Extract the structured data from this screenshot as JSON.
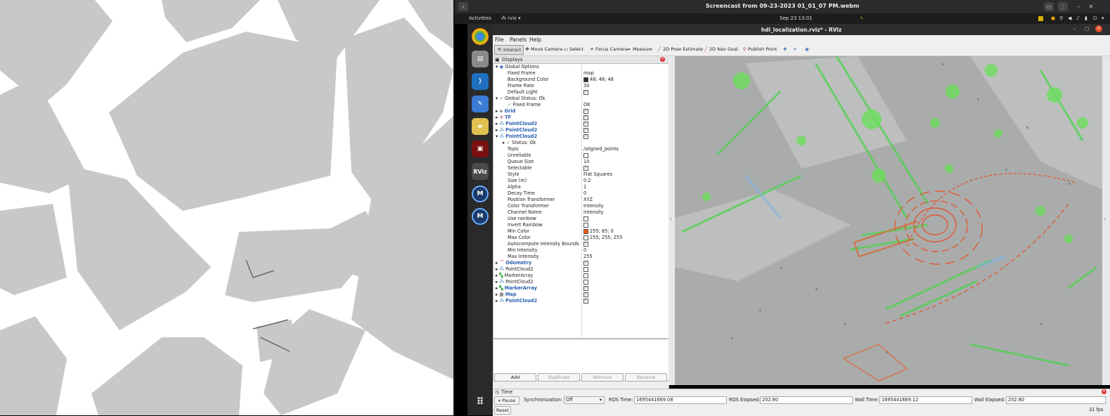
{
  "video": {
    "title": "Screencast from 09-23-2023 01_01_07 PM.webm"
  },
  "gnome": {
    "activities": "Activities",
    "app": "rviz",
    "clock": "Sep 23  13:01"
  },
  "dock": {
    "rviz_label": "RViz",
    "m_label": "M"
  },
  "rviz": {
    "title": "hdl_localization.rviz* - RViz",
    "menu": [
      "File",
      "Panels",
      "Help"
    ],
    "tools": [
      "Interact",
      "Move Camera",
      "Select",
      "Focus Camera",
      "Measure",
      "2D Pose Estimate",
      "2D Nav Goal",
      "Publish Point"
    ],
    "displays_title": "Displays",
    "rows": [
      {
        "label": "Global Options",
        "value": ""
      },
      {
        "label": "Fixed Frame",
        "value": "map"
      },
      {
        "label": "Background Color",
        "value": "48; 48; 48"
      },
      {
        "label": "Frame Rate",
        "value": "30"
      },
      {
        "label": "Default Light",
        "value": ""
      },
      {
        "label": "Global Status: Ok",
        "value": ""
      },
      {
        "label": "Fixed Frame",
        "value": "OK"
      },
      {
        "label": "Grid",
        "value": ""
      },
      {
        "label": "TF",
        "value": ""
      },
      {
        "label": "PointCloud2",
        "value": ""
      },
      {
        "label": "PointCloud2",
        "value": ""
      },
      {
        "label": "PointCloud2",
        "value": ""
      },
      {
        "label": "Status: Ok",
        "value": ""
      },
      {
        "label": "Topic",
        "value": "/aligned_points"
      },
      {
        "label": "Unreliable",
        "value": ""
      },
      {
        "label": "Queue Size",
        "value": "10"
      },
      {
        "label": "Selectable",
        "value": ""
      },
      {
        "label": "Style",
        "value": "Flat Squares"
      },
      {
        "label": "Size (m)",
        "value": "0.2"
      },
      {
        "label": "Alpha",
        "value": "1"
      },
      {
        "label": "Decay Time",
        "value": "0"
      },
      {
        "label": "Position Transformer",
        "value": "XYZ"
      },
      {
        "label": "Color Transformer",
        "value": "Intensity"
      },
      {
        "label": "Channel Name",
        "value": "intensity"
      },
      {
        "label": "Use rainbow",
        "value": ""
      },
      {
        "label": "Invert Rainbow",
        "value": ""
      },
      {
        "label": "Min Color",
        "value": "255; 85; 0"
      },
      {
        "label": "Max Color",
        "value": "255; 255; 255"
      },
      {
        "label": "Autocompute Intensity Bounds",
        "value": ""
      },
      {
        "label": "Min Intensity",
        "value": "0"
      },
      {
        "label": "Max Intensity",
        "value": "255"
      },
      {
        "label": "Odometry",
        "value": ""
      },
      {
        "label": "PointCloud2",
        "value": ""
      },
      {
        "label": "MarkerArray",
        "value": ""
      },
      {
        "label": "PointCloud2",
        "value": ""
      },
      {
        "label": "MarkerArray",
        "value": ""
      },
      {
        "label": "Map",
        "value": ""
      },
      {
        "label": "PointCloud2",
        "value": ""
      }
    ],
    "buttons": {
      "add": "Add",
      "duplicate": "Duplicate",
      "remove": "Remove",
      "rename": "Rename"
    },
    "time": {
      "panel_title": "Time",
      "pause": "Pause",
      "sync_label": "Synchronization:",
      "sync_value": "Off",
      "ros_time_label": "ROS Time:",
      "ros_time": "1695441669.08",
      "ros_elapsed_label": "ROS Elapsed:",
      "ros_elapsed": "202.80",
      "wall_time_label": "Wall Time:",
      "wall_time": "1695441669.12",
      "wall_elapsed_label": "Wall Elapsed:",
      "wall_elapsed": "202.80",
      "reset": "Reset",
      "fps": "31 fps"
    }
  }
}
